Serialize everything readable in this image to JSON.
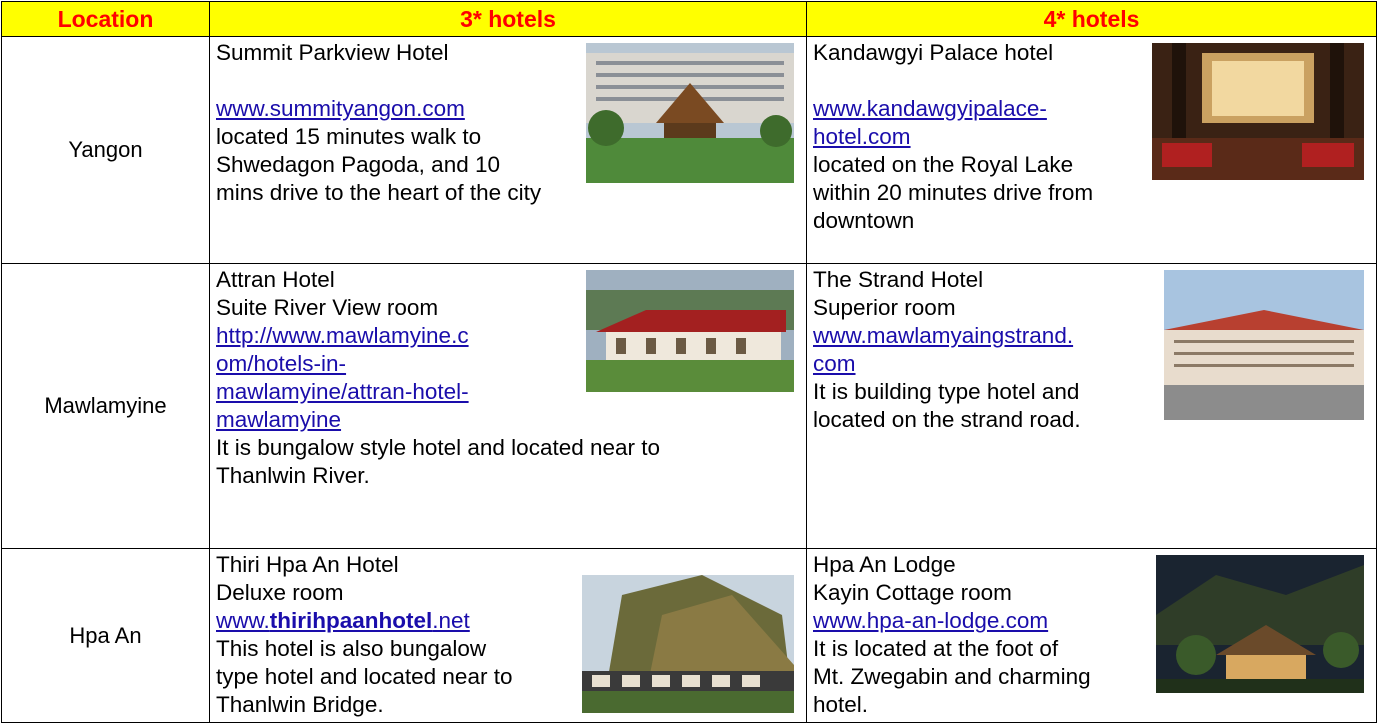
{
  "headers": {
    "location": "Location",
    "three_star": "3* hotels",
    "four_star": "4* hotels"
  },
  "rows": [
    {
      "location": "Yangon",
      "three": {
        "name": "Summit Parkview Hotel",
        "link": "www.summityangon.com",
        "desc1": "located 15 minutes walk to",
        "desc2": "Shwedagon Pagoda, and 10",
        "desc3": "mins drive to the heart of the city"
      },
      "four": {
        "name": "Kandawgyi Palace hotel",
        "link1": "www.kandawgyipalace-",
        "link2": "hotel.com",
        "desc1": "located on the Royal Lake",
        "desc2": "within 20 minutes drive from downtown"
      }
    },
    {
      "location": "Mawlamyine",
      "three": {
        "name": "Attran Hotel",
        "room": "Suite River View room",
        "link1": "http://www.mawlamyine.c",
        "link2": "om/hotels-in-",
        "link3": "mawlamyine/attran-hotel-",
        "link4": "mawlamyine",
        "desc1": "It is bungalow style hotel and located near to",
        "desc2": "Thanlwin River."
      },
      "four": {
        "name": "The Strand Hotel",
        "room": "Superior room",
        "link1": "www.mawlamyaingstrand.",
        "link2": "com",
        "desc1": "It is building type hotel and",
        "desc2": "located on the strand road."
      }
    },
    {
      "location": "Hpa An",
      "three": {
        "name": "Thiri Hpa An Hotel",
        "room": "Deluxe room",
        "link_pre": "www.",
        "link_bold": "thirihpaanhotel",
        "link_post": ".net",
        "desc1": "This hotel is also bungalow",
        "desc2": "type hotel and located near to Thanlwin Bridge."
      },
      "four": {
        "name": "Hpa An Lodge",
        "room": "Kayin Cottage room",
        "link": "www.hpa-an-lodge.com",
        "desc1": "It is located at the foot of",
        "desc2": "Mt. Zwegabin and charming hotel."
      }
    }
  ]
}
